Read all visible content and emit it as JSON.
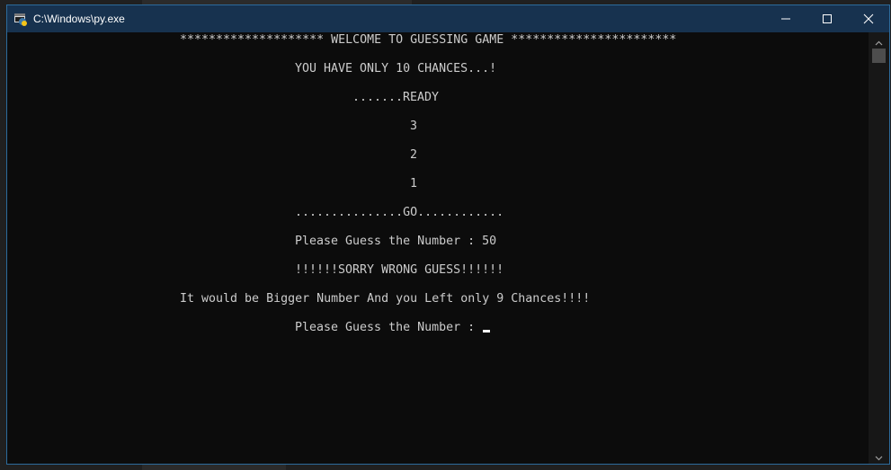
{
  "window": {
    "title": "C:\\Windows\\py.exe"
  },
  "icons": {
    "app": "python-icon",
    "minimize": "minimize-icon",
    "maximize": "maximize-icon",
    "close": "close-icon",
    "scroll_up": "chevron-up-icon",
    "scroll_down": "chevron-down-icon"
  },
  "console": {
    "lines": [
      "******************** WELCOME TO GUESSING GAME ***********************",
      "YOU HAVE ONLY 10 CHANCES...!",
      ".......READY",
      "3",
      "2",
      "1",
      "...............GO............",
      "Please Guess the Number : 50",
      "!!!!!!SORRY WRONG GUESS!!!!!!",
      "It would be Bigger Number And you Left only 9 Chances!!!!",
      "Please Guess the Number : "
    ]
  },
  "colors": {
    "titlebar": "#17324f",
    "console_bg": "#0c0c0c",
    "console_text": "#cccccc",
    "border": "#2c6b9c"
  }
}
